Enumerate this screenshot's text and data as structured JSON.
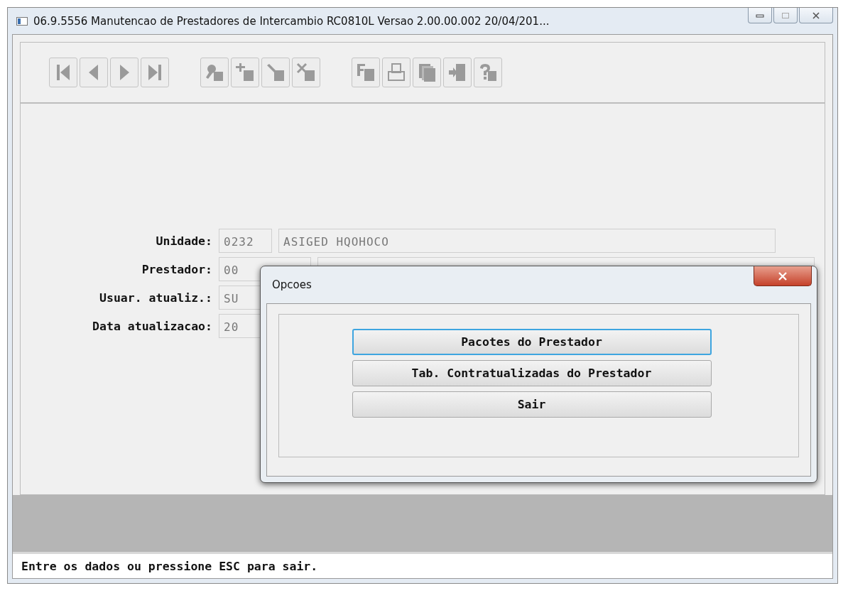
{
  "window": {
    "title": "06.9.5556 Manutencao de Prestadores de Intercambio RC0810L Versao 2.00.00.002 20/04/201..."
  },
  "form": [
    {
      "label": "Unidade:",
      "code": "0232",
      "name_field": true,
      "name": "ASIGED HQOHOCO"
    },
    {
      "label": "Prestador:",
      "code": "00",
      "name_field": true
    },
    {
      "label": "Usuar. atualiz.:",
      "code": "SU"
    },
    {
      "label": "Data atualizacao:",
      "code": "20"
    }
  ],
  "dialog": {
    "title": "Opcoes",
    "buttons": [
      {
        "label": "Pacotes do Prestador",
        "focused": true
      },
      {
        "label": "Tab. Contratualizadas do Prestador",
        "focused": false
      },
      {
        "label": "Sair",
        "focused": false
      }
    ]
  },
  "status_bar": "Entre os dados ou pressione ESC para sair."
}
